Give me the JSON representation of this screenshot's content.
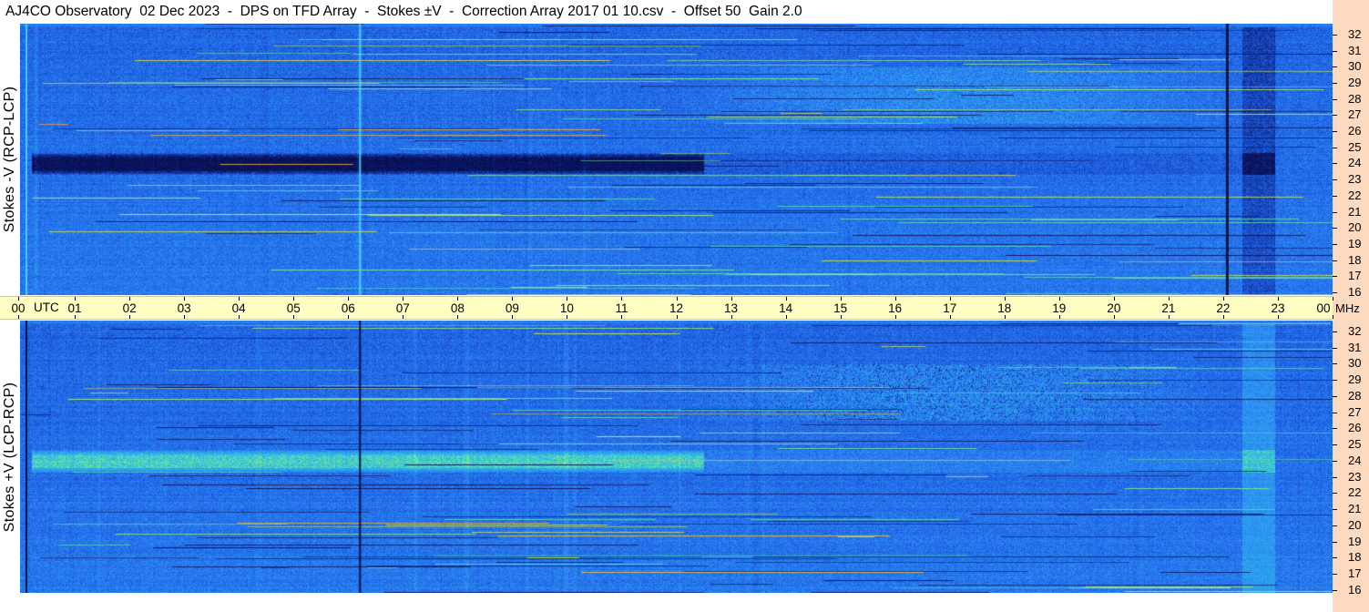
{
  "title": "AJ4CO Observatory  02 Dec 2023  -  DPS on TFD Array  -  Stokes ±V  -  Correction Array 2017 01 10.csv  -  Offset 50  Gain 2.0",
  "panels": {
    "top_label": "Stokes -V (RCP-LCP)",
    "bottom_label": "Stokes +V (LCP-RCP)"
  },
  "colors": {
    "utc_band": "#ffffc4",
    "freq_strip": "#fdd9bf",
    "base_blue": "#1e5fe6",
    "dark_navy": "#0a1460",
    "cyan": "#29b6e8",
    "yellow_green": "#e6f53c"
  },
  "chart_data": {
    "type": "heatmap",
    "x_axis": {
      "unit_label": "UTC",
      "range": [
        0,
        24
      ],
      "tick_labels": [
        "00",
        "01",
        "02",
        "03",
        "04",
        "05",
        "06",
        "07",
        "08",
        "09",
        "10",
        "11",
        "12",
        "13",
        "14",
        "15",
        "16",
        "17",
        "18",
        "19",
        "20",
        "21",
        "22",
        "23",
        "00"
      ]
    },
    "y_axis": {
      "unit_label": "MHz",
      "range": [
        16,
        32.5
      ],
      "tick_labels": [
        "32",
        "31",
        "30",
        "29",
        "28",
        "27",
        "26",
        "25",
        "24",
        "23",
        "22",
        "21",
        "20",
        "19",
        "18",
        "17",
        "16"
      ],
      "tick_values": [
        32,
        31,
        30,
        29,
        28,
        27,
        26,
        25,
        24,
        23,
        22,
        21,
        20,
        19,
        18,
        17,
        16
      ]
    },
    "series": [
      {
        "name": "Stokes -V (RCP-LCP)",
        "features": {
          "dark_band_mhz": [
            23.3,
            24.7
          ],
          "dark_band_utc": [
            0.2,
            12.5
          ],
          "activity_utc": [
            12.0,
            22.2
          ],
          "activity_mhz": [
            26.5,
            30.0
          ],
          "dark_column_utc": [
            22.05,
            22.1
          ],
          "dark_block_utc": [
            22.35,
            22.95
          ]
        }
      },
      {
        "name": "Stokes +V (LCP-RCP)",
        "features": {
          "bright_band_mhz": [
            23.3,
            24.7
          ],
          "bright_band_utc": [
            0.2,
            12.5
          ],
          "activity_utc": [
            12.0,
            22.2
          ],
          "activity_mhz": [
            26.5,
            30.0
          ],
          "bright_block_utc": [
            22.35,
            22.95
          ]
        }
      }
    ]
  }
}
